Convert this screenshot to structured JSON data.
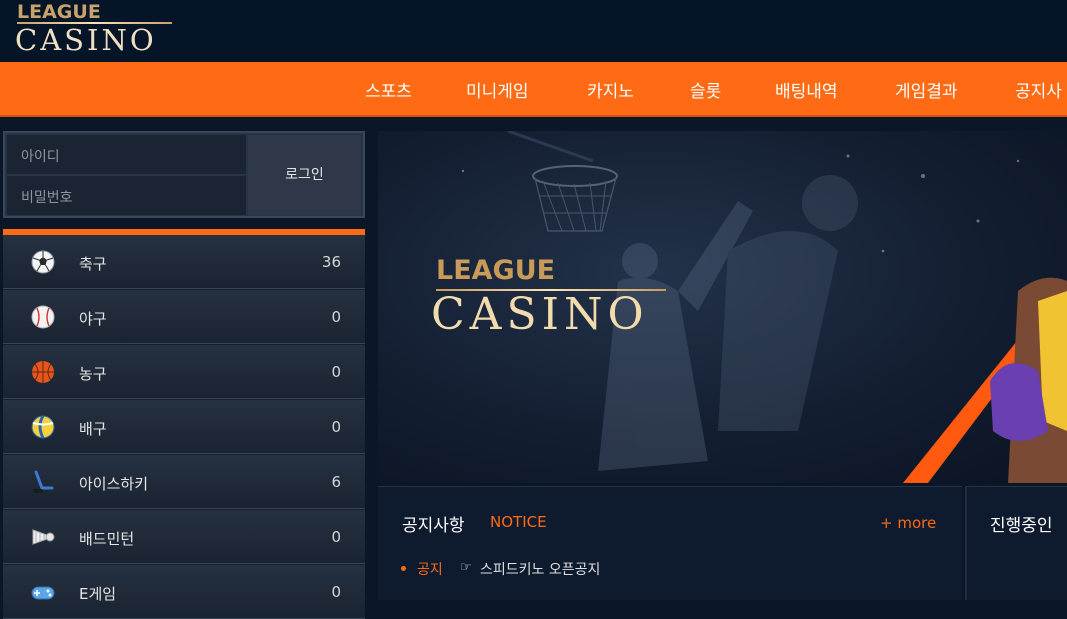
{
  "header": {
    "logo_top": "LEAGUE",
    "logo_bottom": "CASINO"
  },
  "nav": {
    "items": [
      {
        "label": "스포츠"
      },
      {
        "label": "미니게임"
      },
      {
        "label": "카지노"
      },
      {
        "label": "슬롯"
      },
      {
        "label": "배팅내역"
      },
      {
        "label": "게임결과"
      },
      {
        "label": "공지사"
      }
    ]
  },
  "login": {
    "id_placeholder": "아이디",
    "pw_placeholder": "비밀번호",
    "button_label": "로그인"
  },
  "sports": [
    {
      "name": "축구",
      "count": "36",
      "icon": "soccer-ball-icon"
    },
    {
      "name": "야구",
      "count": "0",
      "icon": "baseball-icon"
    },
    {
      "name": "농구",
      "count": "0",
      "icon": "basketball-icon"
    },
    {
      "name": "배구",
      "count": "0",
      "icon": "volleyball-icon"
    },
    {
      "name": "아이스하키",
      "count": "6",
      "icon": "hockey-icon"
    },
    {
      "name": "배드민턴",
      "count": "0",
      "icon": "shuttlecock-icon"
    },
    {
      "name": "E게임",
      "count": "0",
      "icon": "gamepad-icon"
    }
  ],
  "banner": {
    "logo_top": "LEAGUE",
    "logo_bottom": "CASINO"
  },
  "notice": {
    "title": "공지사항",
    "title_en": "NOTICE",
    "more_label": "+ more",
    "items": [
      {
        "tag": "공지",
        "text": "스피드키노 오픈공지"
      }
    ]
  },
  "progress": {
    "title": "진행중인"
  },
  "colors": {
    "accent": "#ff6a14",
    "background": "#0b1628",
    "gold": "#c89b58"
  }
}
